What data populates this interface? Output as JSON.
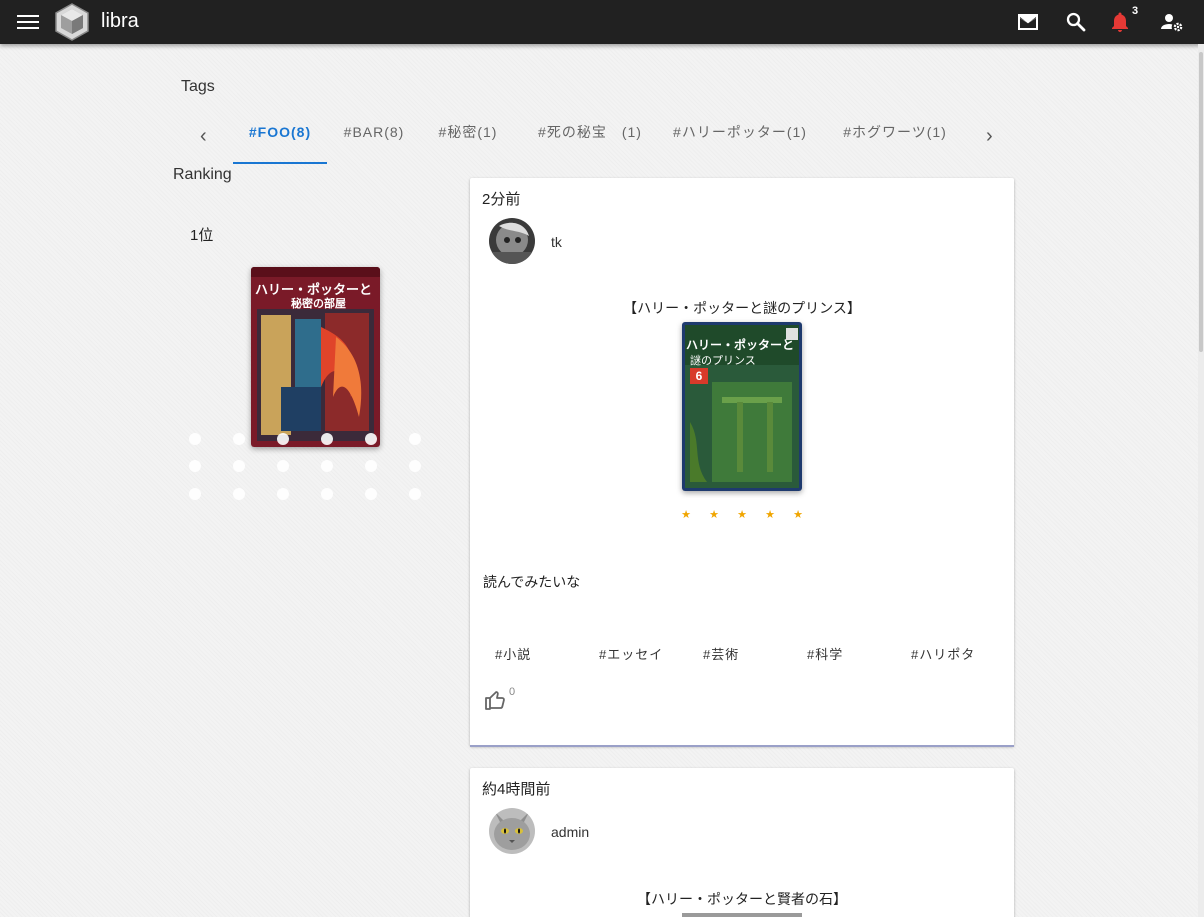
{
  "app": {
    "title": "libra"
  },
  "header": {
    "icons": [
      "menu-icon",
      "app-logo",
      "mail-icon",
      "search-icon",
      "bell-icon",
      "user-settings-icon"
    ],
    "notification_count": "3"
  },
  "tags_section": {
    "title": "Tags",
    "tabs": [
      {
        "label": "#FOO(8)",
        "active": true
      },
      {
        "label": "#BAR(8)",
        "active": false
      },
      {
        "label": "#秘密(1)",
        "active": false
      },
      {
        "label": "#死の秘宝　(1)",
        "active": false
      },
      {
        "label": "#ハリーポッター(1)",
        "active": false
      },
      {
        "label": "#ホグワーツ(1)",
        "active": false
      }
    ]
  },
  "ranking": {
    "title": "Ranking",
    "items": [
      {
        "rank_label": "1位",
        "cover_lines": [
          "ハリー・ポッターと",
          "秘密の部屋"
        ]
      }
    ]
  },
  "posts": [
    {
      "time": "2分前",
      "user": "tk",
      "book_title": "【ハリー・ポッターと謎のプリンス】",
      "cover_lines": [
        "ハリー・ポッターと",
        "謎のプリンス",
        "6"
      ],
      "rating": 5,
      "review": "読んでみたいな",
      "tags": [
        "#小説",
        "#エッセイ",
        "#芸術",
        "#科学",
        "#ハリポタ"
      ],
      "likes": "0"
    },
    {
      "time": "約4時間前",
      "user": "admin",
      "book_title": "【ハリー・ポッターと賢者の石】"
    }
  ],
  "colors": {
    "accent": "#1976d2",
    "star": "#f0a500",
    "notification": "#e53935",
    "topbar": "#212121"
  }
}
